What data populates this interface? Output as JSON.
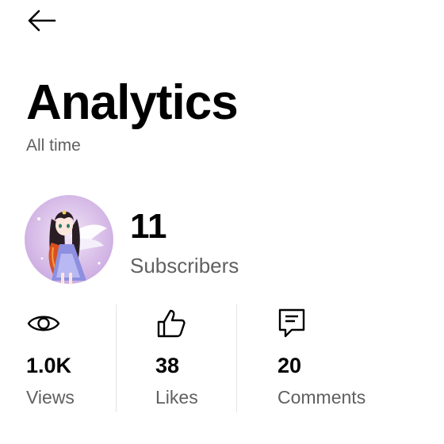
{
  "header": {
    "back_icon": "arrow-left-icon"
  },
  "title": "Analytics",
  "period": "All time",
  "channel": {
    "avatar": "anime-character-avatar",
    "subscriber_count": "11",
    "subscriber_label": "Subscribers"
  },
  "stats": [
    {
      "icon": "eye-icon",
      "value": "1.0K",
      "label": "Views"
    },
    {
      "icon": "thumbs-up-icon",
      "value": "38",
      "label": "Likes"
    },
    {
      "icon": "comment-icon",
      "value": "20",
      "label": "Comments"
    }
  ],
  "colors": {
    "text": "#000000",
    "secondary_text": "#606060",
    "divider": "#e5e5e5",
    "background": "#ffffff"
  }
}
